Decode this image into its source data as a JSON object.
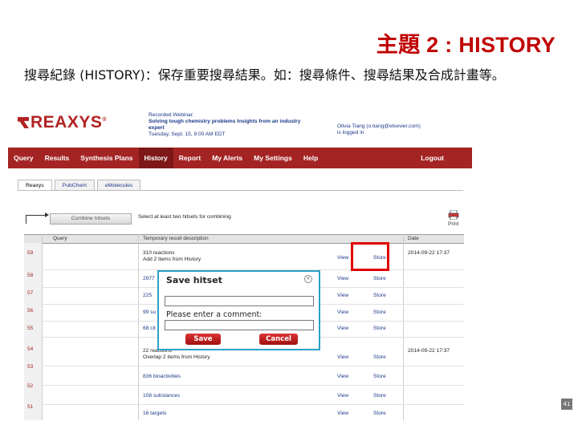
{
  "slide": {
    "title": "主題 2 : HISTORY",
    "body": "搜尋紀錄 (HISTORY)：保存重要搜尋結果。如：搜尋條件、搜尋結果及合成計畫等。",
    "page_number": "41"
  },
  "brand": {
    "name": "REAXYS",
    "mark": "®"
  },
  "webinar": {
    "line1": "Recorded Webinar:",
    "line2": "Solving tough chemistry problems Insights from an industry",
    "line3": "expert",
    "line4": "Tuesday, Sept. 15, 9:00 AM EDT"
  },
  "user": {
    "line1": "Olivia Tiang (o.tiang@elsevier.com)",
    "line2": "is logged in"
  },
  "nav": {
    "items": [
      "Query",
      "Results",
      "Synthesis Plans",
      "History",
      "Report",
      "My Alerts",
      "My Settings",
      "Help"
    ],
    "active": "History",
    "logout": "Logout"
  },
  "tabs": {
    "items": [
      "Reaxys",
      "PubChem",
      "eMolecules"
    ],
    "active": "Reaxys"
  },
  "toolbar": {
    "combine_button": "Combine hitsets",
    "hint": "Select at least two hitsets for combining",
    "print_label": "Print"
  },
  "table": {
    "headers": {
      "query": "Query",
      "description": "Temporary result description",
      "date": "Date"
    },
    "rows": [
      {
        "num": "59",
        "desc": "310 reactions",
        "desc2": "Add 2 items from History",
        "view": "View",
        "store": "Store",
        "date": "2014-09-22 17:37"
      },
      {
        "num": "58",
        "desc": "2977",
        "desc2": "",
        "view": "View",
        "store": "Store",
        "date": ""
      },
      {
        "num": "57",
        "desc": "225",
        "desc2": "",
        "view": "View",
        "store": "Store",
        "date": ""
      },
      {
        "num": "56",
        "desc": "99 su",
        "desc2": "",
        "view": "View",
        "store": "Store",
        "date": ""
      },
      {
        "num": "55",
        "desc": "68 cit",
        "desc2": "",
        "view": "View",
        "store": "Store",
        "date": ""
      },
      {
        "num": "54",
        "desc": "22 reactions",
        "desc2": "Overlap 2 items from History",
        "view": "View",
        "store": "Store",
        "date": "2014-09-22 17:37"
      },
      {
        "num": "53",
        "desc": "836 bioactivities",
        "desc2": "",
        "view": "View",
        "store": "Store",
        "date": ""
      },
      {
        "num": "52",
        "desc": "108 substances",
        "desc2": "",
        "view": "View",
        "store": "Store",
        "date": ""
      },
      {
        "num": "51",
        "desc": "16 targets",
        "desc2": "",
        "view": "View",
        "store": "Store",
        "date": ""
      }
    ]
  },
  "dialog": {
    "title": "Save hitset",
    "close": "×",
    "hitset_name_value": "",
    "comment_label": "Please enter a comment:",
    "comment_value": "",
    "save": "Save",
    "cancel": "Cancel"
  },
  "colors": {
    "title": "#c00000",
    "nav": "#a42424",
    "highlight": "#e00000",
    "dialog_border": "#2aa1c4"
  }
}
